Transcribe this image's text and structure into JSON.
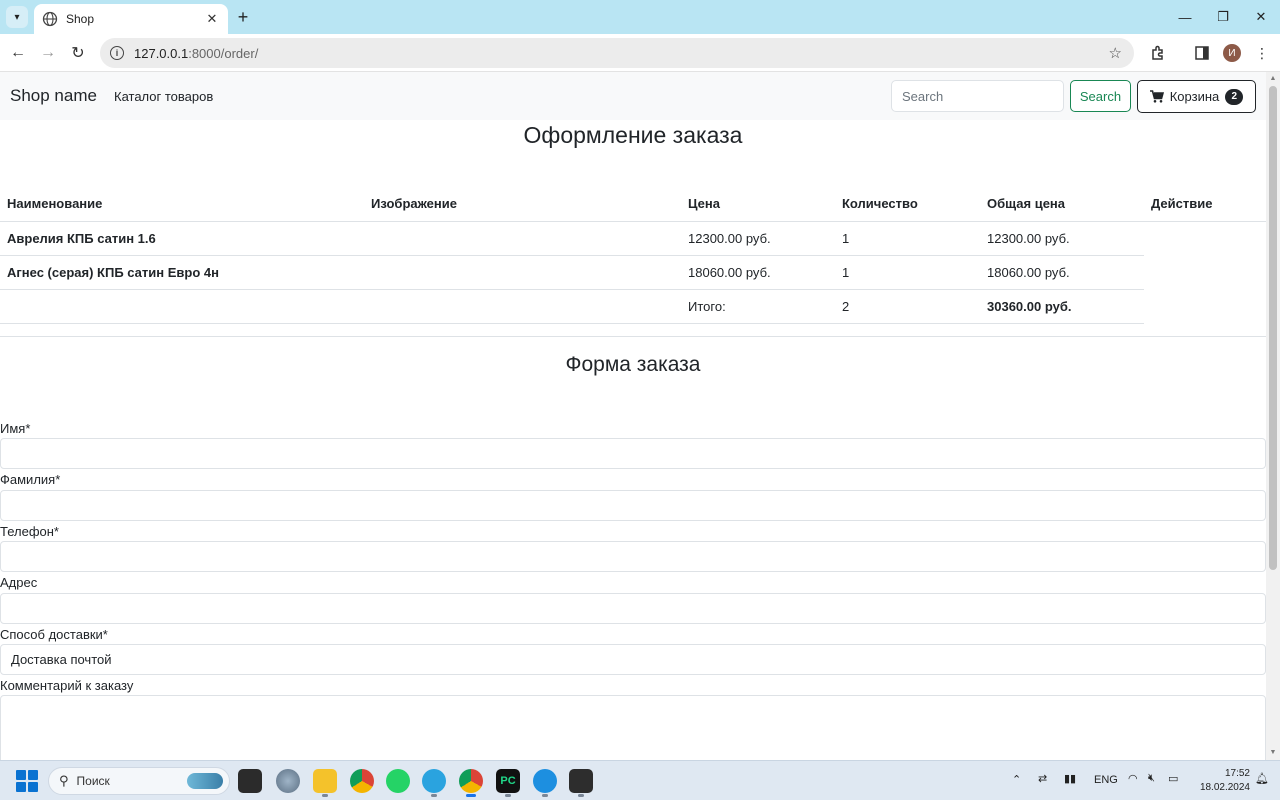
{
  "browser": {
    "tab_title": "Shop",
    "new_tab_symbol": "+",
    "url_host": "127.0.0.1",
    "url_path": ":8000/order/",
    "profile_initial": "И"
  },
  "navbar": {
    "brand": "Shop name",
    "catalog_link": "Каталог товаров",
    "search_placeholder": "Search",
    "search_button": "Search",
    "cart_label": "Корзина",
    "cart_count": "2"
  },
  "order": {
    "heading": "Оформление заказа",
    "columns": [
      "Наименование",
      "Изображение",
      "Цена",
      "Количество",
      "Общая цена",
      "Действие"
    ],
    "rows": [
      {
        "name": "Аврелия КПБ сатин 1.6",
        "image": "",
        "price": "12300.00 руб.",
        "quantity": "1",
        "total": "12300.00 руб.",
        "action": ""
      },
      {
        "name": "Агнес (серая) КПБ сатин Евро 4н",
        "image": "",
        "price": "18060.00 руб.",
        "quantity": "1",
        "total": "18060.00 руб.",
        "action": ""
      }
    ],
    "summary": {
      "label": "Итого:",
      "quantity": "2",
      "total": "30360.00 руб."
    }
  },
  "form": {
    "heading": "Форма заказа",
    "first_name_label": "Имя*",
    "last_name_label": "Фамилия*",
    "phone_label": "Телефон*",
    "address_label": "Адрес",
    "delivery_label": "Способ доставки*",
    "delivery_value": "Доставка почтой",
    "comment_label": "Комментарий к заказу"
  },
  "taskbar": {
    "search_label": "Поиск",
    "language": "ENG",
    "time": "17:52",
    "date": "18.02.2024"
  },
  "colors": {
    "success": "#198754",
    "dark": "#212529",
    "navbar_bg": "#f8f9fa",
    "border": "#dee2e6",
    "tabbar_bg": "#b9e5f3"
  }
}
